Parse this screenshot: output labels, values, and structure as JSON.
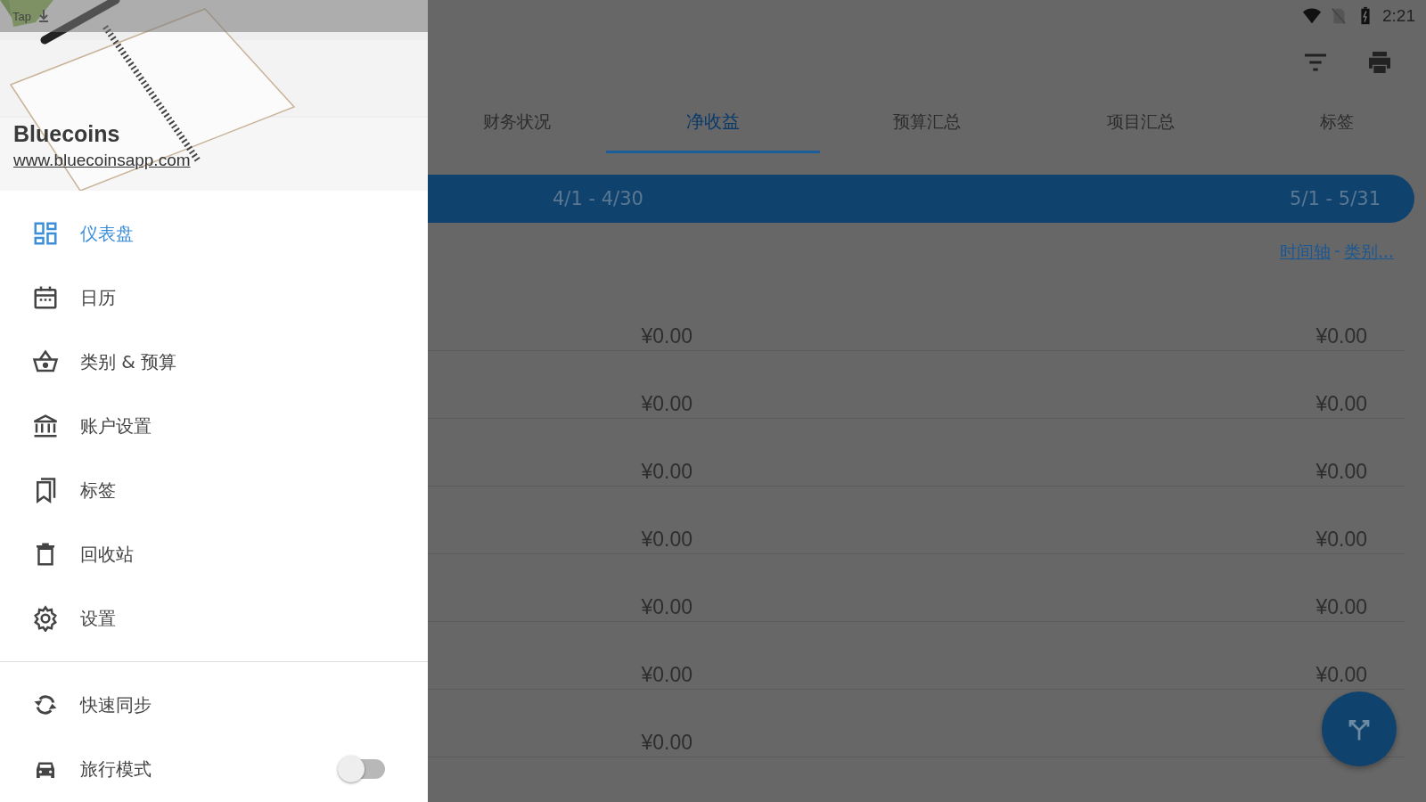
{
  "status_bar": {
    "notification": "Tap",
    "time": "2:21"
  },
  "drawer": {
    "app_name": "Bluecoins",
    "website": "www.bluecoinsapp.com",
    "items": [
      {
        "label": "仪表盘",
        "selected": true
      },
      {
        "label": "日历",
        "selected": false
      },
      {
        "label": "类别 & 预算",
        "selected": false
      },
      {
        "label": "账户设置",
        "selected": false
      },
      {
        "label": "标签",
        "selected": false
      },
      {
        "label": "回收站",
        "selected": false
      },
      {
        "label": "设置",
        "selected": false
      }
    ],
    "extra_items": [
      {
        "label": "快速同步",
        "kind": "action"
      },
      {
        "label": "旅行模式",
        "kind": "toggle",
        "on": false
      }
    ]
  },
  "tabs": [
    {
      "label": "财务状况",
      "selected": false
    },
    {
      "label": "净收益",
      "selected": true
    },
    {
      "label": "预算汇总",
      "selected": false
    },
    {
      "label": "项目汇总",
      "selected": false
    },
    {
      "label": "标签",
      "selected": false
    }
  ],
  "periods": [
    "4/1 - 4/30",
    "5/1 - 5/31"
  ],
  "links": {
    "first": "时间轴",
    "separator": "-",
    "second": "类别..."
  },
  "rows": [
    {
      "values": [
        "¥0.00",
        "¥0.00"
      ]
    },
    {
      "values": [
        "¥0.00",
        "¥0.00"
      ]
    },
    {
      "values": [
        "¥0.00",
        "¥0.00"
      ]
    },
    {
      "values": [
        "¥0.00",
        "¥0.00"
      ]
    },
    {
      "values": [
        "¥0.00",
        "¥0.00"
      ]
    },
    {
      "values": [
        "¥0.00",
        "¥0.00"
      ]
    },
    {
      "values": [
        "¥0.00"
      ]
    }
  ]
}
